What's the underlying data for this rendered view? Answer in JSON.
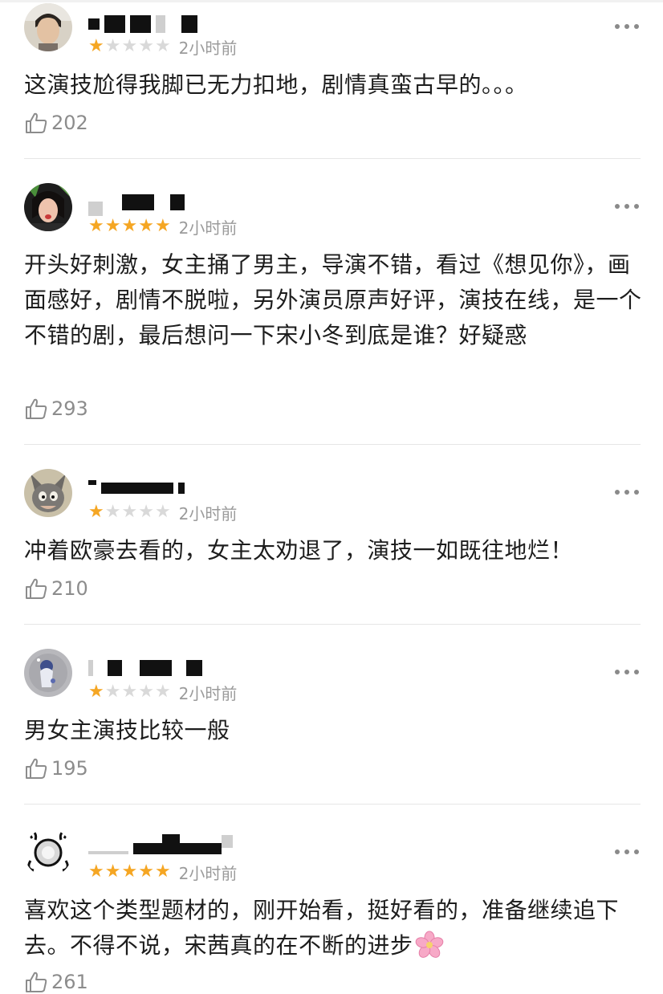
{
  "reviews": [
    {
      "rating": 1,
      "time": "2小时前",
      "content": "这演技尬得我脚已无力扣地，剧情真蛮古早的。。。",
      "likes": "202"
    },
    {
      "rating": 5,
      "time": "2小时前",
      "content": "开头好刺激，女主捅了男主，导演不错，看过《想见你》，画面感好，剧情不脱啦，另外演员原声好评，演技在线，是一个不错的剧，最后想问一下宋小冬到底是谁？好疑惑",
      "likes": "293"
    },
    {
      "rating": 1,
      "time": "2小时前",
      "content": "冲着欧豪去看的，女主太劝退了，演技一如既往地烂！",
      "likes": "210"
    },
    {
      "rating": 1,
      "time": "2小时前",
      "content": "男女主演技比较一般",
      "likes": "195"
    },
    {
      "rating": 5,
      "time": "2小时前",
      "content": "喜欢这个类型题材的，刚开始看，挺好看的，准备继续追下去。不得不说，宋茜真的在不断的进步",
      "emoji": "cherry-blossom",
      "likes": "261"
    }
  ],
  "colors": {
    "star_on": "#f5a623",
    "star_off": "#d9d9d9",
    "meta_text": "#9b9b9b",
    "divider": "#e6e6e6"
  },
  "icons": {
    "like": "thumbs-up-icon",
    "more": "more-dots-icon"
  }
}
